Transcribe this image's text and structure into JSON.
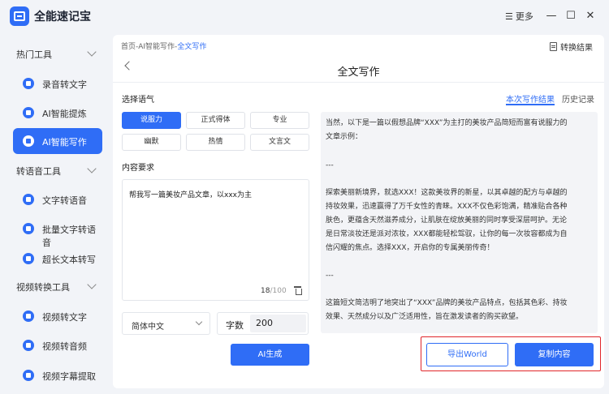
{
  "app": {
    "title": "全能速记宝",
    "more_label": "更多"
  },
  "colors": {
    "accent": "#2f6df6",
    "highlight": "#e0262b"
  },
  "sidebar": {
    "groups": [
      {
        "label": "热门工具",
        "items": [
          {
            "label": "录音转文字"
          },
          {
            "label": "AI智能提炼"
          },
          {
            "label": "AI智能写作",
            "active": true
          }
        ]
      },
      {
        "label": "转语音工具",
        "items": [
          {
            "label": "文字转语音"
          },
          {
            "label": "批量文字转语音"
          },
          {
            "label": "超长文本转写"
          }
        ]
      },
      {
        "label": "视频转换工具",
        "items": [
          {
            "label": "视频转文字"
          },
          {
            "label": "视频转音频"
          },
          {
            "label": "视频字幕提取"
          }
        ]
      }
    ]
  },
  "main": {
    "breadcrumb": {
      "path": "首页-AI智能写作-",
      "current": "全文写作"
    },
    "convert_result_label": "转换结果",
    "page_title": "全文写作",
    "tone": {
      "label": "选择语气",
      "options": [
        "说服力",
        "正式得体",
        "专业",
        "幽默",
        "热情",
        "文言文"
      ],
      "selected": "说服力"
    },
    "content_req": {
      "label": "内容要求",
      "value": "帮我写一篇美妆产品文章，以xxx为主",
      "count": "18",
      "max": "/100"
    },
    "language_select": {
      "value": "简体中文"
    },
    "word_count": {
      "label": "字数",
      "value": "200"
    },
    "generate_label": "AI生成",
    "tabs": {
      "current": "本次写作结果",
      "history": "历史记录"
    },
    "result_lines": [
      "当然，以下是一篇以假想品牌“XXX”为主打的美妆产品简短而富有说服力的",
      "文章示例：",
      "",
      "---",
      "",
      "探索美丽新境界，就选XXX！这款美妆界的新星，以其卓越的配方与卓越的",
      "持妆效果，迅速赢得了万千女性的青睐。XXX不仅色彩饱满，精准贴合各种",
      "肤色，更蕴含天然滋养成分，让肌肤在绽放美丽的同时享受深层呵护。无论",
      "是日常淡妆还是派对浓妆，XXX都能轻松驾驭，让你的每一次妆容都成为自",
      "信闪耀的焦点。选择XXX，开启你的专属美丽传奇！",
      "",
      "---",
      "",
      "这篇短文简洁明了地突出了“XXX”品牌的美妆产品特点，包括其色彩、持妆",
      "效果、天然成分以及广泛适用性，旨在激发读者的购买欲望。"
    ],
    "export_label": "导出World",
    "copy_label": "复制内容"
  }
}
